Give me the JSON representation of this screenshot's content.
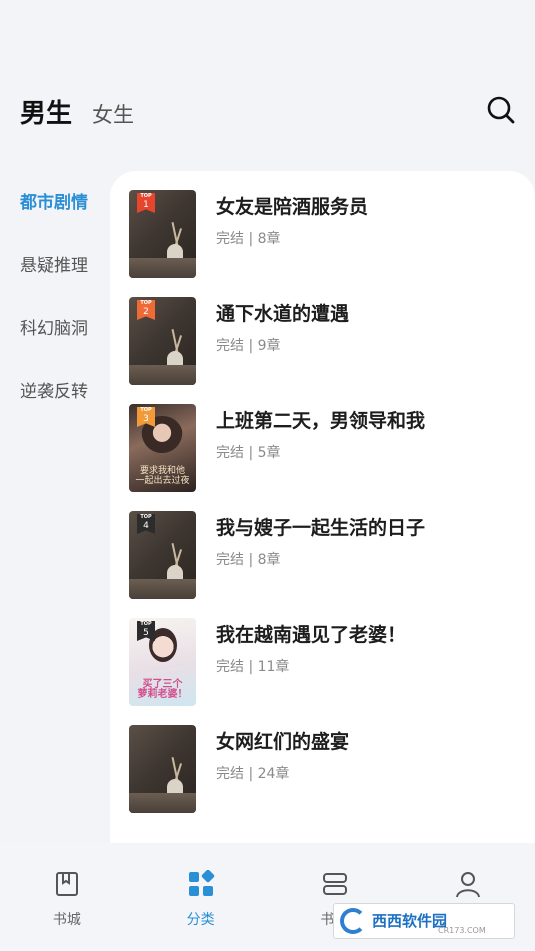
{
  "header": {
    "tabs": [
      {
        "label": "男生",
        "active": true
      },
      {
        "label": "女生",
        "active": false
      }
    ],
    "search_icon": "search-icon"
  },
  "sidebar": {
    "categories": [
      {
        "label": "都市剧情",
        "active": true
      },
      {
        "label": "悬疑推理",
        "active": false
      },
      {
        "label": "科幻脑洞",
        "active": false
      },
      {
        "label": "逆袭反转",
        "active": false
      }
    ]
  },
  "books": [
    {
      "rank_top": "TOP",
      "rank": "1",
      "title": "女友是陪酒服务员",
      "meta": "完结 | 8章"
    },
    {
      "rank_top": "TOP",
      "rank": "2",
      "title": "通下水道的遭遇",
      "meta": "完结 | 9章"
    },
    {
      "rank_top": "TOP",
      "rank": "3",
      "title": "上班第二天，男领导和我",
      "meta": "完结 | 5章",
      "cover_text": "要求我和他\n一起出去过夜"
    },
    {
      "rank_top": "TOP",
      "rank": "4",
      "title": "我与嫂子一起生活的日子",
      "meta": "完结 | 8章"
    },
    {
      "rank_top": "TOP",
      "rank": "5",
      "title": "我在越南遇见了老婆！",
      "meta": "完结 | 11章",
      "cover_text": "买了三个\n萝莉老婆！"
    },
    {
      "rank_top": "",
      "rank": "",
      "title": "女网红们的盛宴",
      "meta": "完结 | 24章"
    }
  ],
  "bottom_nav": [
    {
      "label": "书城",
      "icon": "book-icon",
      "active": false
    },
    {
      "label": "分类",
      "icon": "category-grid-icon",
      "active": true
    },
    {
      "label": "书架",
      "icon": "bookshelf-icon",
      "active": false
    },
    {
      "label": "",
      "icon": "user-icon",
      "active": false
    }
  ],
  "watermark": {
    "text": "西西软件园",
    "sub": "CR173.COM"
  },
  "colors": {
    "accent": "#2b8fd6",
    "rank1": "#e8452f",
    "rank2": "#ee6a36",
    "rank3": "#f29a3a",
    "background": "#f3f4f7"
  }
}
